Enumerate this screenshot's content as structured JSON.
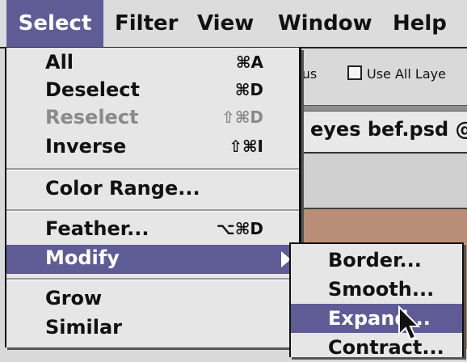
{
  "menubar": {
    "items": [
      {
        "label": "Select",
        "active": true
      },
      {
        "label": "Filter",
        "active": false
      },
      {
        "label": "View",
        "active": false
      },
      {
        "label": "Window",
        "active": false
      },
      {
        "label": "Help",
        "active": false
      }
    ]
  },
  "options_bar": {
    "partial_label": "ous",
    "checkbox_label": "Use All Laye"
  },
  "document": {
    "title": "eyes bef.psd @"
  },
  "select_menu": {
    "items": [
      {
        "label": "All",
        "shortcut": "⌘A",
        "enabled": true
      },
      {
        "label": "Deselect",
        "shortcut": "⌘D",
        "enabled": true
      },
      {
        "label": "Reselect",
        "shortcut": "⇧⌘D",
        "enabled": false
      },
      {
        "label": "Inverse",
        "shortcut": "⇧⌘I",
        "enabled": true
      },
      {
        "label": "Color Range...",
        "shortcut": "",
        "enabled": true
      },
      {
        "label": "Feather...",
        "shortcut": "⌥⌘D",
        "enabled": true
      },
      {
        "label": "Modify",
        "shortcut": "",
        "enabled": true,
        "highlighted": true,
        "submenu": true
      },
      {
        "label": "Grow",
        "shortcut": "",
        "enabled": true
      },
      {
        "label": "Similar",
        "shortcut": "",
        "enabled": true
      }
    ]
  },
  "modify_submenu": {
    "items": [
      {
        "label": "Border...",
        "highlighted": false
      },
      {
        "label": "Smooth...",
        "highlighted": false
      },
      {
        "label": "Expand...",
        "highlighted": true
      },
      {
        "label": "Contract...",
        "highlighted": false
      }
    ]
  },
  "colors": {
    "highlight": "#5f5c95",
    "menu_bg": "#e6e6e6",
    "disabled_text": "#8a8a8a",
    "image": "#b98e79"
  }
}
